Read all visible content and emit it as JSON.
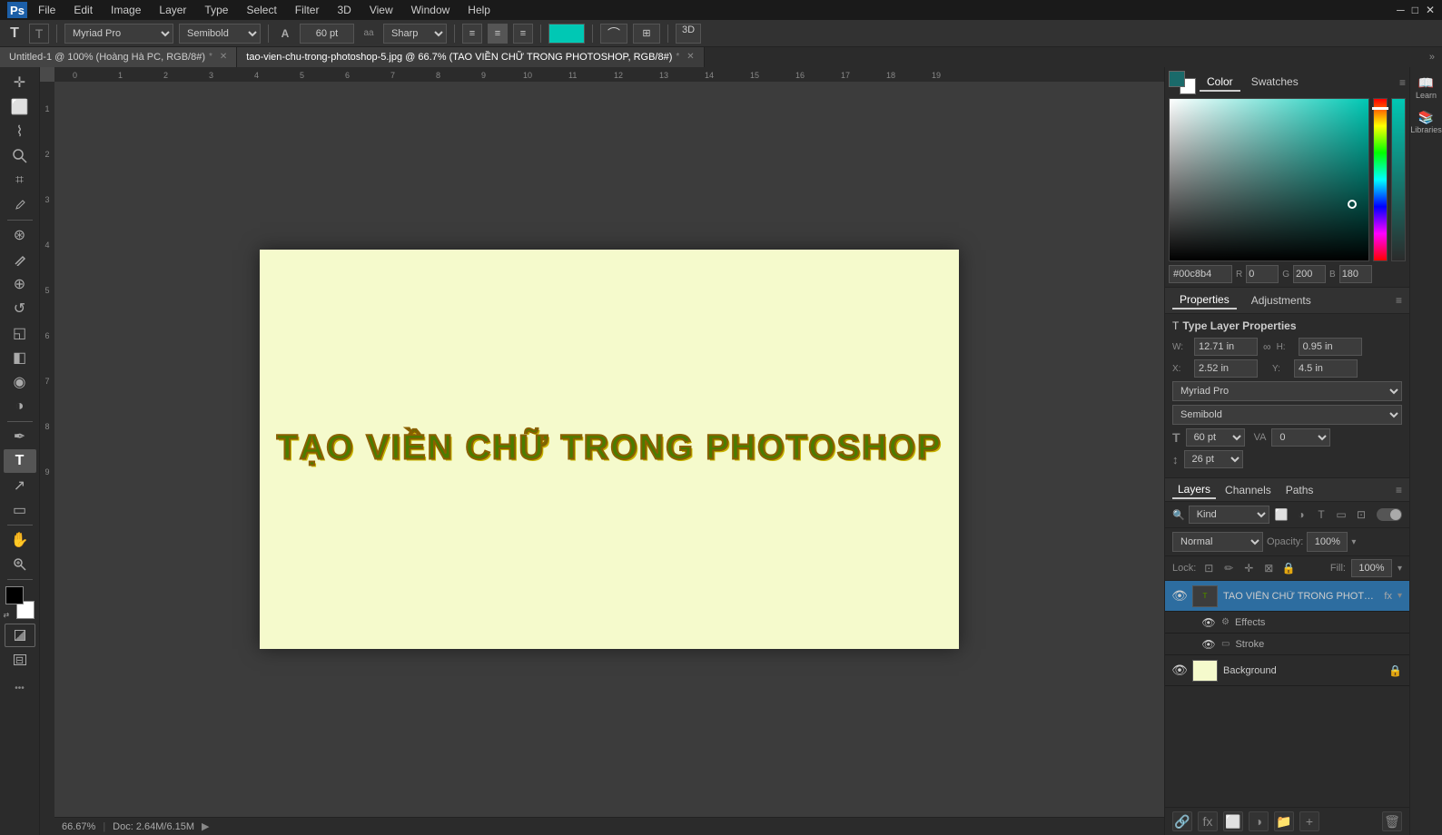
{
  "app": {
    "name": "Adobe Photoshop",
    "logo": "Ps"
  },
  "menu": {
    "items": [
      "File",
      "Edit",
      "Image",
      "Layer",
      "Type",
      "Select",
      "Filter",
      "3D",
      "View",
      "Window",
      "Help"
    ]
  },
  "window_controls": {
    "minimize": "─",
    "maximize": "□",
    "close": "✕"
  },
  "options_bar": {
    "tool_icon_1": "T",
    "tool_icon_2": "T",
    "font_family": "Myriad Pro",
    "font_style": "Semibold",
    "size_icon": "A",
    "font_size": "60 pt",
    "aa_label": "aa",
    "aa_mode": "Sharp",
    "align_left": "≡",
    "align_center": "≡",
    "align_right": "≡",
    "color_value": "#00c8b4",
    "warp_icon": "⌒",
    "options_icon": "⊞",
    "three_d": "3D"
  },
  "tabs": {
    "tab1": {
      "label": "Untitled-1 @ 100% (Hoàng Hà PC, RGB/8#)",
      "active": false,
      "modified": true
    },
    "tab2": {
      "label": "tao-vien-chu-trong-photoshop-5.jpg @ 66.7% (TAO VIỀN CHỮ TRONG PHOTOSHOP, RGB/8#)",
      "active": true,
      "modified": true
    }
  },
  "canvas": {
    "background_color": "#f5facc",
    "main_text": "TẠO VIỀN CHỮ TRONG PHOTOSHOP",
    "text_color": "#4a7c00",
    "zoom": "66.67%",
    "doc_info": "Doc: 2.64M/6.15M"
  },
  "tools": {
    "move": "✛",
    "marquee": "⬜",
    "lasso": "⌇",
    "quick_select": "⊙",
    "crop": "⌗",
    "eyedropper": "⊘",
    "spot_heal": "⊛",
    "brush": "✏",
    "clone": "⊕",
    "history": "↺",
    "eraser": "◱",
    "gradient": "◧",
    "blur": "◉",
    "dodge": "◑",
    "pen": "✒",
    "type": "T",
    "path_select": "↗",
    "rectangle": "▭",
    "hand": "✋",
    "zoom": "⊕",
    "more": "•••"
  },
  "color_panel": {
    "tab_color": "Color",
    "tab_swatches": "Swatches",
    "fg_color": "#000000",
    "bg_color": "#ffffff",
    "accent_color": "#00c8b4"
  },
  "properties_panel": {
    "tab_properties": "Properties",
    "tab_adjustments": "Adjustments",
    "title": "Type Layer Properties",
    "width_label": "W:",
    "width_value": "12.71 in",
    "link_icon": "∞",
    "height_label": "H:",
    "height_value": "0.95 in",
    "x_label": "X:",
    "x_value": "2.52 in",
    "y_label": "Y:",
    "y_value": "4.5 in",
    "font_family": "Myriad Pro",
    "font_style": "Semibold",
    "size_label": "pt",
    "size_value": "60 pt",
    "tracking_icon": "VA",
    "tracking_value": "0",
    "leading_icon": "↕",
    "leading_value": "26 pt"
  },
  "layers_panel": {
    "tab_layers": "Layers",
    "tab_channels": "Channels",
    "tab_paths": "Paths",
    "filter_kind": "Kind",
    "blend_mode": "Normal",
    "opacity_label": "Opacity:",
    "opacity_value": "100%",
    "lock_label": "Lock:",
    "fill_label": "Fill:",
    "fill_value": "100%",
    "layers": [
      {
        "id": 1,
        "name": "TAO VIỀN CHỮ TRONG PHOTOSH...",
        "type": "text",
        "visible": true,
        "active": true,
        "has_fx": true,
        "fx_label": "fx",
        "sub_items": [
          {
            "name": "Effects"
          },
          {
            "name": "Stroke"
          }
        ]
      },
      {
        "id": 2,
        "name": "Background",
        "type": "fill",
        "visible": true,
        "active": false,
        "locked": true,
        "thumb_color": "#f5facc"
      }
    ]
  },
  "status_bar": {
    "zoom": "66.67%",
    "doc_info": "Doc: 2.64M/6.15M",
    "arrow": "▶"
  }
}
